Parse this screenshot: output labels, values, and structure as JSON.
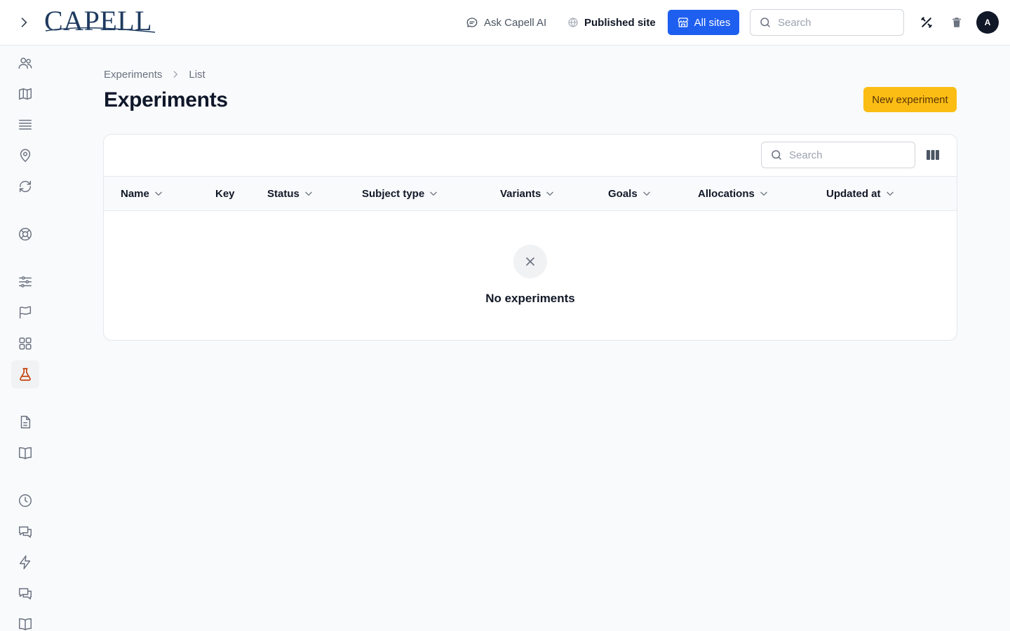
{
  "header": {
    "logo_text": "CAPELL",
    "ask_ai_label": "Ask Capell AI",
    "published_label": "Published site",
    "all_sites_label": "All sites",
    "search_placeholder": "Search",
    "avatar_initial": "A"
  },
  "sidebar": {
    "items": [
      {
        "icon": "users-icon"
      },
      {
        "icon": "map-icon"
      },
      {
        "icon": "list-icon"
      },
      {
        "icon": "location-pin-icon"
      },
      {
        "icon": "refresh-icon"
      },
      {
        "icon": "lifebuoy-icon"
      },
      {
        "icon": "sliders-icon"
      },
      {
        "icon": "flag-icon"
      },
      {
        "icon": "grid-icon"
      },
      {
        "icon": "beaker-icon",
        "active": true
      },
      {
        "icon": "document-icon"
      },
      {
        "icon": "book-icon"
      },
      {
        "icon": "clock-icon"
      },
      {
        "icon": "chat-icon"
      },
      {
        "icon": "lightning-icon"
      },
      {
        "icon": "chat-icon"
      },
      {
        "icon": "book-icon"
      }
    ]
  },
  "breadcrumb": {
    "items": [
      "Experiments",
      "List"
    ]
  },
  "page": {
    "title": "Experiments",
    "new_button_label": "New experiment"
  },
  "table": {
    "search_placeholder": "Search",
    "columns": [
      {
        "label": "Name",
        "sortable": true
      },
      {
        "label": "Key",
        "sortable": false
      },
      {
        "label": "Status",
        "sortable": true
      },
      {
        "label": "Subject type",
        "sortable": true
      },
      {
        "label": "Variants",
        "sortable": true
      },
      {
        "label": "Goals",
        "sortable": true
      },
      {
        "label": "Allocations",
        "sortable": true
      },
      {
        "label": "Updated at",
        "sortable": true
      }
    ],
    "rows": [],
    "empty_message": "No experiments"
  },
  "colors": {
    "primary": "#1f5ff0",
    "accent": "#fbbd14",
    "active_icon": "#c2410c"
  }
}
